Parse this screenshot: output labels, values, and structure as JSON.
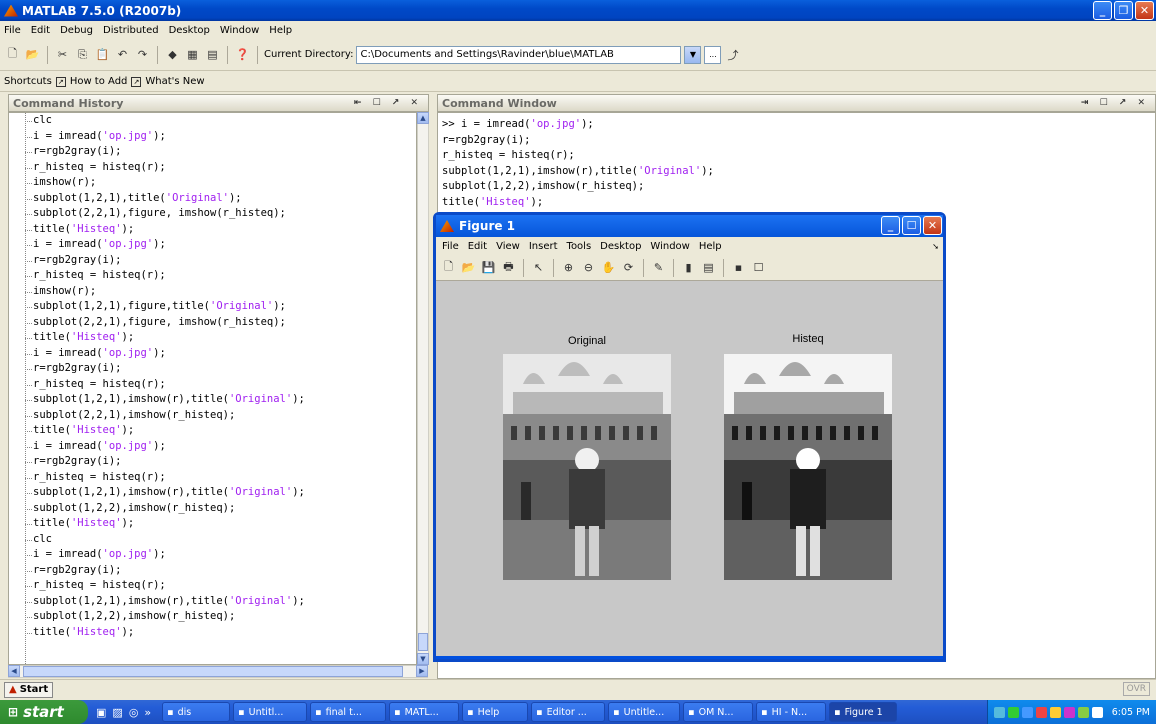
{
  "app": {
    "title": "MATLAB  7.5.0 (R2007b)",
    "menu": [
      "File",
      "Edit",
      "Debug",
      "Distributed",
      "Desktop",
      "Window",
      "Help"
    ],
    "current_directory_label": "Current Directory:",
    "current_directory": "C:\\Documents and Settings\\Ravinder\\blue\\MATLAB",
    "browse_label": "...",
    "shortcuts": {
      "label": "Shortcuts",
      "how_to_add": "How to Add",
      "whats_new": "What's New"
    }
  },
  "history": {
    "title": "Command History",
    "lines": [
      [
        "clc",
        ""
      ],
      [
        "i = imread(",
        "'op.jpg'",
        ");"
      ],
      [
        "r=rgb2gray(i);"
      ],
      [
        "r_histeq = histeq(r);"
      ],
      [
        "imshow(r);"
      ],
      [
        "subplot(1,2,1),title(",
        "'Original'",
        ");"
      ],
      [
        "subplot(2,2,1),figure, imshow(r_histeq);"
      ],
      [
        "title(",
        "'Histeq'",
        ");"
      ],
      [
        "i = imread(",
        "'op.jpg'",
        ");"
      ],
      [
        "r=rgb2gray(i);"
      ],
      [
        "r_histeq = histeq(r);"
      ],
      [
        "imshow(r);"
      ],
      [
        "subplot(1,2,1),figure,title(",
        "'Original'",
        ");"
      ],
      [
        "subplot(2,2,1),figure, imshow(r_histeq);"
      ],
      [
        "title(",
        "'Histeq'",
        ");"
      ],
      [
        "i = imread(",
        "'op.jpg'",
        ");"
      ],
      [
        "r=rgb2gray(i);"
      ],
      [
        "r_histeq = histeq(r);"
      ],
      [
        "subplot(1,2,1),imshow(r),title(",
        "'Original'",
        ");"
      ],
      [
        "subplot(2,2,1),imshow(r_histeq);"
      ],
      [
        "title(",
        "'Histeq'",
        ");"
      ],
      [
        "i = imread(",
        "'op.jpg'",
        ");"
      ],
      [
        "r=rgb2gray(i);"
      ],
      [
        "r_histeq = histeq(r);"
      ],
      [
        "subplot(1,2,1),imshow(r),title(",
        "'Original'",
        ");"
      ],
      [
        "subplot(1,2,2),imshow(r_histeq);"
      ],
      [
        "title(",
        "'Histeq'",
        ");"
      ],
      [
        "clc"
      ],
      [
        "i = imread(",
        "'op.jpg'",
        ");"
      ],
      [
        "r=rgb2gray(i);"
      ],
      [
        "r_histeq = histeq(r);"
      ],
      [
        "subplot(1,2,1),imshow(r),title(",
        "'Original'",
        ");"
      ],
      [
        "subplot(1,2,2),imshow(r_histeq);"
      ],
      [
        "title(",
        "'Histeq'",
        ");"
      ]
    ]
  },
  "command_window": {
    "title": "Command Window",
    "lines": [
      [
        ">> i = imread(",
        "'op.jpg'",
        ");"
      ],
      [
        "r=rgb2gray(i);"
      ],
      [
        "r_histeq = histeq(r);"
      ],
      [
        "subplot(1,2,1),imshow(r),title(",
        "'Original'",
        ");"
      ],
      [
        "subplot(1,2,2),imshow(r_histeq);"
      ],
      [
        "title(",
        "'Histeq'",
        ");"
      ]
    ]
  },
  "figure": {
    "title": "Figure 1",
    "menu": [
      "File",
      "Edit",
      "View",
      "Insert",
      "Tools",
      "Desktop",
      "Window",
      "Help"
    ],
    "left_title": "Original",
    "right_title": "Histeq"
  },
  "status": {
    "start_label": "Start",
    "ovr": "OVR"
  },
  "taskbar": {
    "start": "start",
    "tasks": [
      "dis",
      "Untitl...",
      "final t...",
      "MATL...",
      "Help",
      "Editor ...",
      "Untitle...",
      "OM N...",
      "HI - N...",
      "Figure 1"
    ],
    "clock": "6:05 PM"
  },
  "colors": {
    "string": "#a020f0",
    "titlebar": "#0049c8"
  }
}
